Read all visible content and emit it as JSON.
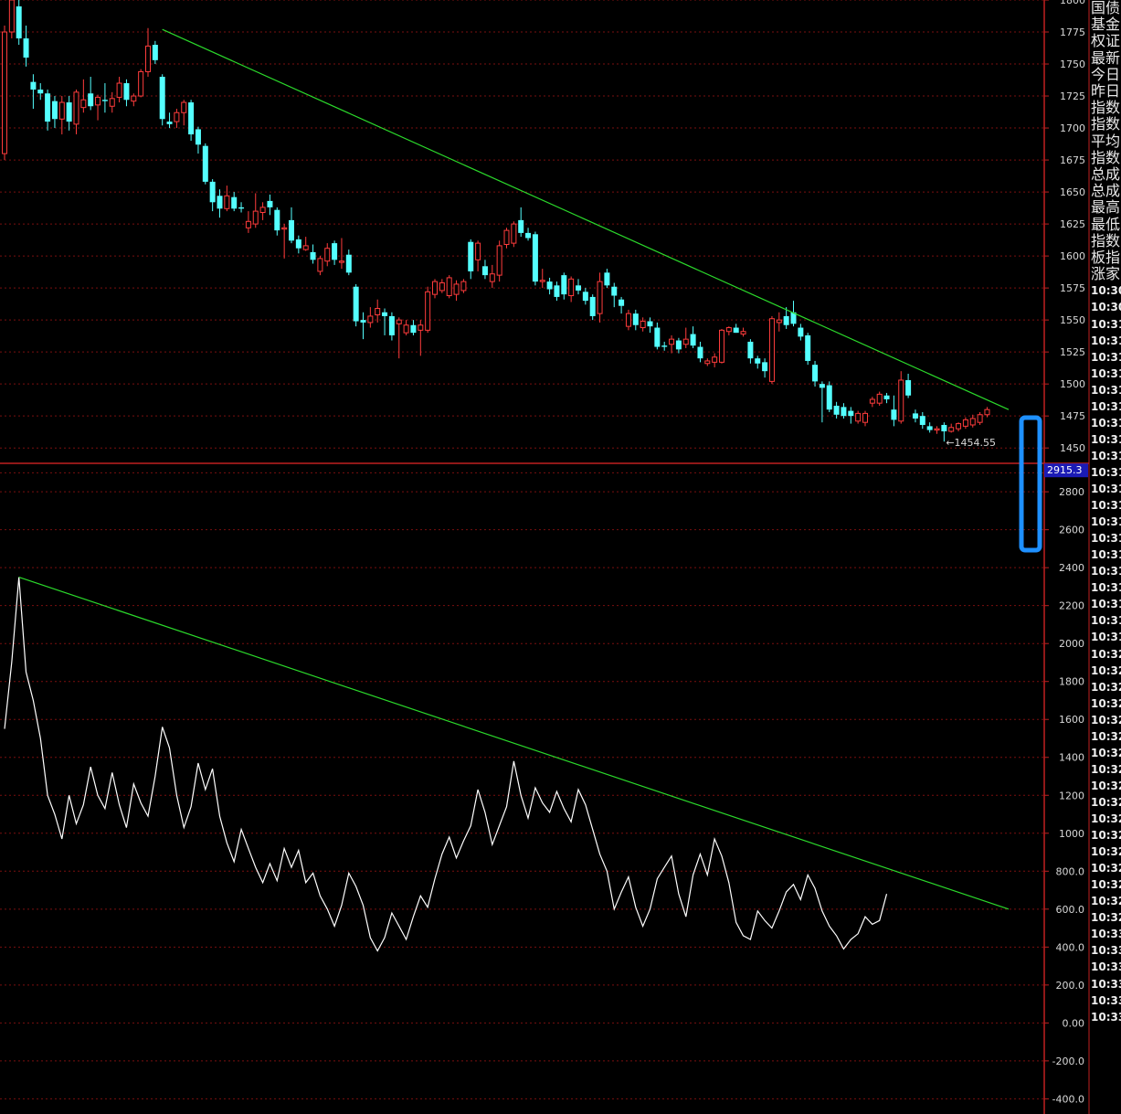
{
  "colors": {
    "background": "#000000",
    "up_candle": "#ff3c3c",
    "down_candle": "#54ffff",
    "trendline": "#2bd92b",
    "indicator_line": "#ffffff",
    "axis": "#c02020",
    "grid": "#7a0f0f",
    "label_box": "#1b1bb5",
    "highlight": "#1e90ff"
  },
  "sidebar": {
    "labels": [
      "国债",
      "基金",
      "权证",
      "最新",
      "今日",
      "昨日",
      "指数",
      "指数",
      "平均",
      "指数",
      "总成",
      "总成",
      "最高",
      "最低",
      "指数",
      "板指",
      "涨家"
    ],
    "times": [
      "10:30",
      "10:30",
      "10:31",
      "10:31",
      "10:31",
      "10:31",
      "10:31",
      "10:31",
      "10:31",
      "10:31",
      "10:31",
      "10:31",
      "10:31",
      "10:31",
      "10:31",
      "10:31",
      "10:31",
      "10:31",
      "10:31",
      "10:31",
      "10:31",
      "10:31",
      "10:32",
      "10:32",
      "10:32",
      "10:32",
      "10:32",
      "10:32",
      "10:32",
      "10:32",
      "10:32",
      "10:32",
      "10:32",
      "10:32",
      "10:32",
      "10:32",
      "10:32",
      "10:32",
      "10:32",
      "10:33",
      "10:33",
      "10:33",
      "10:33",
      "10:33",
      "10:33"
    ]
  },
  "chart_data": [
    {
      "type": "candlestick",
      "ylim": [
        1438,
        1800
      ],
      "y_ticks": [
        "1800",
        "1775",
        "1750",
        "1725",
        "1700",
        "1675",
        "1650",
        "1625",
        "1600",
        "1575",
        "1550",
        "1525",
        "1500",
        "1475",
        "1450"
      ],
      "min_annotation": {
        "label": "←1454.55",
        "value": 1454.55
      },
      "candles": [
        {
          "o": 1680,
          "c": 1775,
          "h": 1780,
          "l": 1675
        },
        {
          "o": 1775,
          "c": 1800,
          "h": 1810,
          "l": 1770
        },
        {
          "o": 1795,
          "c": 1770,
          "h": 1805,
          "l": 1765
        },
        {
          "o": 1770,
          "c": 1755,
          "h": 1780,
          "l": 1748
        },
        {
          "o": 1736,
          "c": 1730,
          "h": 1742,
          "l": 1715
        },
        {
          "o": 1730,
          "c": 1727,
          "h": 1735,
          "l": 1722
        },
        {
          "o": 1727,
          "c": 1705,
          "h": 1730,
          "l": 1698
        },
        {
          "o": 1721,
          "c": 1707,
          "h": 1725,
          "l": 1700
        },
        {
          "o": 1707,
          "c": 1720,
          "h": 1725,
          "l": 1695
        },
        {
          "o": 1720,
          "c": 1705,
          "h": 1725,
          "l": 1698
        },
        {
          "o": 1703,
          "c": 1728,
          "h": 1730,
          "l": 1695
        },
        {
          "o": 1716,
          "c": 1722,
          "h": 1738,
          "l": 1712
        },
        {
          "o": 1727,
          "c": 1717,
          "h": 1740,
          "l": 1714
        },
        {
          "o": 1718,
          "c": 1724,
          "h": 1726,
          "l": 1706
        },
        {
          "o": 1722,
          "c": 1721,
          "h": 1735,
          "l": 1712
        },
        {
          "o": 1717,
          "c": 1723,
          "h": 1728,
          "l": 1712
        },
        {
          "o": 1724,
          "c": 1735,
          "h": 1740,
          "l": 1720
        },
        {
          "o": 1735,
          "c": 1722,
          "h": 1738,
          "l": 1717
        },
        {
          "o": 1721,
          "c": 1725,
          "h": 1727,
          "l": 1717
        },
        {
          "o": 1725,
          "c": 1744,
          "h": 1746,
          "l": 1724
        },
        {
          "o": 1744,
          "c": 1764,
          "h": 1778,
          "l": 1740
        },
        {
          "o": 1765,
          "c": 1753,
          "h": 1768,
          "l": 1750
        },
        {
          "o": 1740,
          "c": 1707,
          "h": 1742,
          "l": 1702
        },
        {
          "o": 1705,
          "c": 1703,
          "h": 1712,
          "l": 1700
        },
        {
          "o": 1705,
          "c": 1712,
          "h": 1715,
          "l": 1700
        },
        {
          "o": 1712,
          "c": 1720,
          "h": 1722,
          "l": 1702
        },
        {
          "o": 1720,
          "c": 1695,
          "h": 1722,
          "l": 1690
        },
        {
          "o": 1699,
          "c": 1687,
          "h": 1701,
          "l": 1680
        },
        {
          "o": 1686,
          "c": 1658,
          "h": 1688,
          "l": 1656
        },
        {
          "o": 1658,
          "c": 1642,
          "h": 1660,
          "l": 1635
        },
        {
          "o": 1647,
          "c": 1637,
          "h": 1652,
          "l": 1630
        },
        {
          "o": 1637,
          "c": 1647,
          "h": 1655,
          "l": 1635
        },
        {
          "o": 1646,
          "c": 1637,
          "h": 1650,
          "l": 1635
        },
        {
          "o": 1638,
          "c": 1637,
          "h": 1642,
          "l": 1634
        },
        {
          "o": 1622,
          "c": 1627,
          "h": 1635,
          "l": 1618
        },
        {
          "o": 1625,
          "c": 1635,
          "h": 1649,
          "l": 1622
        },
        {
          "o": 1634,
          "c": 1638,
          "h": 1642,
          "l": 1628
        },
        {
          "o": 1643,
          "c": 1638,
          "h": 1648,
          "l": 1632
        },
        {
          "o": 1636,
          "c": 1620,
          "h": 1638,
          "l": 1616
        },
        {
          "o": 1621,
          "c": 1622,
          "h": 1625,
          "l": 1598
        },
        {
          "o": 1628,
          "c": 1612,
          "h": 1638,
          "l": 1610
        },
        {
          "o": 1613,
          "c": 1606,
          "h": 1616,
          "l": 1602
        },
        {
          "o": 1605,
          "c": 1608,
          "h": 1615,
          "l": 1604
        },
        {
          "o": 1603,
          "c": 1597,
          "h": 1609,
          "l": 1594
        },
        {
          "o": 1588,
          "c": 1598,
          "h": 1600,
          "l": 1585
        },
        {
          "o": 1596,
          "c": 1606,
          "h": 1610,
          "l": 1592
        },
        {
          "o": 1610,
          "c": 1597,
          "h": 1612,
          "l": 1593
        },
        {
          "o": 1595,
          "c": 1596,
          "h": 1614,
          "l": 1590
        },
        {
          "o": 1601,
          "c": 1587,
          "h": 1605,
          "l": 1585
        },
        {
          "o": 1576,
          "c": 1549,
          "h": 1578,
          "l": 1545
        },
        {
          "o": 1550,
          "c": 1548,
          "h": 1556,
          "l": 1535
        },
        {
          "o": 1548,
          "c": 1553,
          "h": 1560,
          "l": 1544
        },
        {
          "o": 1554,
          "c": 1559,
          "h": 1566,
          "l": 1548
        },
        {
          "o": 1556,
          "c": 1553,
          "h": 1559,
          "l": 1538
        },
        {
          "o": 1553,
          "c": 1538,
          "h": 1556,
          "l": 1534
        },
        {
          "o": 1547,
          "c": 1550,
          "h": 1552,
          "l": 1520
        },
        {
          "o": 1540,
          "c": 1546,
          "h": 1550,
          "l": 1538
        },
        {
          "o": 1546,
          "c": 1540,
          "h": 1550,
          "l": 1538
        },
        {
          "o": 1542,
          "c": 1546,
          "h": 1550,
          "l": 1522
        },
        {
          "o": 1542,
          "c": 1572,
          "h": 1576,
          "l": 1540
        },
        {
          "o": 1570,
          "c": 1580,
          "h": 1582,
          "l": 1567
        },
        {
          "o": 1573,
          "c": 1579,
          "h": 1582,
          "l": 1571
        },
        {
          "o": 1569,
          "c": 1583,
          "h": 1585,
          "l": 1567
        },
        {
          "o": 1570,
          "c": 1578,
          "h": 1581,
          "l": 1565
        },
        {
          "o": 1573,
          "c": 1580,
          "h": 1582,
          "l": 1571
        },
        {
          "o": 1611,
          "c": 1588,
          "h": 1613,
          "l": 1582
        },
        {
          "o": 1597,
          "c": 1610,
          "h": 1612,
          "l": 1588
        },
        {
          "o": 1592,
          "c": 1585,
          "h": 1597,
          "l": 1582
        },
        {
          "o": 1580,
          "c": 1586,
          "h": 1593,
          "l": 1575
        },
        {
          "o": 1585,
          "c": 1608,
          "h": 1612,
          "l": 1580
        },
        {
          "o": 1609,
          "c": 1620,
          "h": 1622,
          "l": 1606
        },
        {
          "o": 1610,
          "c": 1625,
          "h": 1627,
          "l": 1607
        },
        {
          "o": 1628,
          "c": 1618,
          "h": 1638,
          "l": 1615
        },
        {
          "o": 1618,
          "c": 1614,
          "h": 1622,
          "l": 1612
        },
        {
          "o": 1617,
          "c": 1580,
          "h": 1619,
          "l": 1577
        },
        {
          "o": 1580,
          "c": 1581,
          "h": 1590,
          "l": 1575
        },
        {
          "o": 1580,
          "c": 1574,
          "h": 1583,
          "l": 1570
        },
        {
          "o": 1577,
          "c": 1568,
          "h": 1580,
          "l": 1565
        },
        {
          "o": 1585,
          "c": 1570,
          "h": 1587,
          "l": 1566
        },
        {
          "o": 1569,
          "c": 1582,
          "h": 1584,
          "l": 1564
        },
        {
          "o": 1577,
          "c": 1573,
          "h": 1582,
          "l": 1570
        },
        {
          "o": 1572,
          "c": 1565,
          "h": 1575,
          "l": 1562
        },
        {
          "o": 1568,
          "c": 1553,
          "h": 1570,
          "l": 1550
        },
        {
          "o": 1555,
          "c": 1580,
          "h": 1587,
          "l": 1548
        },
        {
          "o": 1587,
          "c": 1577,
          "h": 1590,
          "l": 1575
        },
        {
          "o": 1576,
          "c": 1569,
          "h": 1579,
          "l": 1560
        },
        {
          "o": 1566,
          "c": 1561,
          "h": 1568,
          "l": 1555
        },
        {
          "o": 1545,
          "c": 1555,
          "h": 1558,
          "l": 1542
        },
        {
          "o": 1555,
          "c": 1546,
          "h": 1558,
          "l": 1542
        },
        {
          "o": 1544,
          "c": 1549,
          "h": 1552,
          "l": 1541
        },
        {
          "o": 1549,
          "c": 1545,
          "h": 1552,
          "l": 1540
        },
        {
          "o": 1544,
          "c": 1529,
          "h": 1548,
          "l": 1527
        },
        {
          "o": 1530,
          "c": 1529,
          "h": 1533,
          "l": 1526
        },
        {
          "o": 1531,
          "c": 1535,
          "h": 1538,
          "l": 1524
        },
        {
          "o": 1534,
          "c": 1527,
          "h": 1536,
          "l": 1524
        },
        {
          "o": 1531,
          "c": 1535,
          "h": 1544,
          "l": 1528
        },
        {
          "o": 1539,
          "c": 1530,
          "h": 1545,
          "l": 1528
        },
        {
          "o": 1529,
          "c": 1520,
          "h": 1533,
          "l": 1517
        },
        {
          "o": 1516,
          "c": 1518,
          "h": 1520,
          "l": 1514
        },
        {
          "o": 1517,
          "c": 1521,
          "h": 1524,
          "l": 1513
        },
        {
          "o": 1517,
          "c": 1542,
          "h": 1543,
          "l": 1516
        },
        {
          "o": 1541,
          "c": 1544,
          "h": 1545,
          "l": 1538
        },
        {
          "o": 1544,
          "c": 1540,
          "h": 1547,
          "l": 1540
        },
        {
          "o": 1539,
          "c": 1541,
          "h": 1544,
          "l": 1537
        },
        {
          "o": 1533,
          "c": 1520,
          "h": 1535,
          "l": 1516
        },
        {
          "o": 1520,
          "c": 1516,
          "h": 1522,
          "l": 1512
        },
        {
          "o": 1517,
          "c": 1510,
          "h": 1520,
          "l": 1505
        },
        {
          "o": 1502,
          "c": 1551,
          "h": 1553,
          "l": 1500
        },
        {
          "o": 1548,
          "c": 1550,
          "h": 1556,
          "l": 1541
        },
        {
          "o": 1553,
          "c": 1546,
          "h": 1560,
          "l": 1543
        },
        {
          "o": 1556,
          "c": 1547,
          "h": 1565,
          "l": 1545
        },
        {
          "o": 1544,
          "c": 1537,
          "h": 1547,
          "l": 1534
        },
        {
          "o": 1538,
          "c": 1518,
          "h": 1540,
          "l": 1515
        },
        {
          "o": 1515,
          "c": 1502,
          "h": 1518,
          "l": 1498
        },
        {
          "o": 1500,
          "c": 1497,
          "h": 1502,
          "l": 1470
        },
        {
          "o": 1499,
          "c": 1480,
          "h": 1502,
          "l": 1478
        },
        {
          "o": 1483,
          "c": 1476,
          "h": 1486,
          "l": 1473
        },
        {
          "o": 1482,
          "c": 1475,
          "h": 1485,
          "l": 1473
        },
        {
          "o": 1479,
          "c": 1475,
          "h": 1482,
          "l": 1469
        },
        {
          "o": 1471,
          "c": 1477,
          "h": 1479,
          "l": 1469
        },
        {
          "o": 1470,
          "c": 1477,
          "h": 1479,
          "l": 1467
        },
        {
          "o": 1485,
          "c": 1488,
          "h": 1490,
          "l": 1482
        },
        {
          "o": 1485,
          "c": 1492,
          "h": 1494,
          "l": 1483
        },
        {
          "o": 1491,
          "c": 1488,
          "h": 1493,
          "l": 1485
        },
        {
          "o": 1480,
          "c": 1472,
          "h": 1491,
          "l": 1467
        },
        {
          "o": 1471,
          "c": 1503,
          "h": 1510,
          "l": 1469
        },
        {
          "o": 1503,
          "c": 1491,
          "h": 1508,
          "l": 1489
        },
        {
          "o": 1477,
          "c": 1473,
          "h": 1480,
          "l": 1470
        },
        {
          "o": 1475,
          "c": 1468,
          "h": 1478,
          "l": 1465
        },
        {
          "o": 1467,
          "c": 1464,
          "h": 1470,
          "l": 1462
        },
        {
          "o": 1464,
          "c": 1465,
          "h": 1467,
          "l": 1461
        },
        {
          "o": 1468,
          "c": 1463,
          "h": 1470,
          "l": 1455
        },
        {
          "o": 1463,
          "c": 1466,
          "h": 1469,
          "l": 1462
        },
        {
          "o": 1465,
          "c": 1469,
          "h": 1470,
          "l": 1463
        },
        {
          "o": 1467,
          "c": 1472,
          "h": 1474,
          "l": 1465
        },
        {
          "o": 1468,
          "c": 1473,
          "h": 1476,
          "l": 1466
        },
        {
          "o": 1470,
          "c": 1476,
          "h": 1478,
          "l": 1468
        },
        {
          "o": 1476,
          "c": 1480,
          "h": 1482,
          "l": 1474
        }
      ],
      "trendline": {
        "from": {
          "index": 22,
          "value": 1777
        },
        "to": {
          "index": 140,
          "value": 1480
        }
      }
    },
    {
      "type": "line",
      "ylim": [
        -480,
        2950
      ],
      "y_ticks": [
        "2800",
        "2600",
        "2400",
        "2200",
        "2000",
        "1800",
        "1600",
        "1400",
        "1200",
        "1000",
        "800.0",
        "600.0",
        "400.0",
        "200.0",
        "0.00",
        "-200.0",
        "-400.0"
      ],
      "current_value_label": "2915.3",
      "highlighted_tick": "2900",
      "series": [
        {
          "values": [
            1550,
            1900,
            2350,
            1850,
            1700,
            1500,
            1200,
            1100,
            970,
            1200,
            1050,
            1150,
            1350,
            1200,
            1130,
            1320,
            1150,
            1030,
            1260,
            1160,
            1090,
            1300,
            1560,
            1450,
            1200,
            1030,
            1140,
            1370,
            1230,
            1340,
            1090,
            950,
            850,
            1020,
            920,
            820,
            740,
            840,
            750,
            920,
            820,
            910,
            740,
            790,
            670,
            600,
            510,
            620,
            790,
            720,
            620,
            450,
            380,
            450,
            580,
            510,
            440,
            560,
            670,
            610,
            760,
            890,
            980,
            870,
            960,
            1040,
            1230,
            1110,
            940,
            1040,
            1140,
            1380,
            1200,
            1080,
            1240,
            1160,
            1110,
            1220,
            1130,
            1060,
            1230,
            1150,
            1020,
            890,
            800,
            600,
            690,
            770,
            610,
            510,
            600,
            760,
            820,
            880,
            680,
            560,
            780,
            890,
            780,
            970,
            880,
            740,
            530,
            460,
            440,
            590,
            540,
            500,
            590,
            690,
            730,
            650,
            780,
            710,
            590,
            510,
            460,
            390,
            440,
            470,
            560,
            520,
            540,
            680
          ]
        }
      ],
      "trendline": {
        "from": {
          "index": 2,
          "value": 2350
        },
        "to": {
          "index": 140,
          "value": 600
        }
      }
    }
  ]
}
